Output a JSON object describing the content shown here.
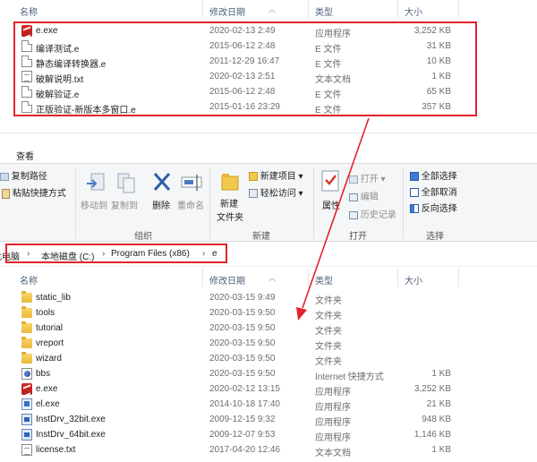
{
  "columns": {
    "name": "名称",
    "date": "修改日期",
    "type": "类型",
    "size": "大小"
  },
  "top_files": [
    {
      "icon": "exe-icon",
      "name": "e.exe",
      "date": "2020-02-13 2:49",
      "type": "应用程序",
      "size": "3,252 KB"
    },
    {
      "icon": "document-icon",
      "name": "编译测试.e",
      "date": "2015-06-12 2:48",
      "type": "E 文件",
      "size": "31 KB"
    },
    {
      "icon": "document-icon",
      "name": "静态编译转换器.e",
      "date": "2011-12-29 16:47",
      "type": "E 文件",
      "size": "10 KB"
    },
    {
      "icon": "text-file-icon",
      "name": "破解说明.txt",
      "date": "2020-02-13 2:51",
      "type": "文本文档",
      "size": "1 KB"
    },
    {
      "icon": "document-icon",
      "name": "破解验证.e",
      "date": "2015-06-12 2:48",
      "type": "E 文件",
      "size": "65 KB"
    },
    {
      "icon": "document-icon",
      "name": "正版验证-新版本多窗口.e",
      "date": "2015-01-16 23:29",
      "type": "E 文件",
      "size": "357 KB"
    }
  ],
  "ribbon": {
    "tab": "查看",
    "copy_path": "复制路径",
    "paste_shortcut": "粘贴快捷方式",
    "move_to": "移动到",
    "copy_to": "复制到",
    "delete": "删除",
    "rename": "重命名",
    "new_folder_1": "新建",
    "new_folder_2": "文件夹",
    "new_item": "新建项目",
    "easy_access": "轻松访问",
    "properties": "属性",
    "open": "打开",
    "edit": "编辑",
    "history": "历史记录",
    "select_all": "全部选择",
    "select_none": "全部取消",
    "invert_selection": "反向选择",
    "group_organize": "组织",
    "group_new": "新建",
    "group_open": "打开",
    "group_select": "选择"
  },
  "address": {
    "crumbs": [
      "此电脑",
      "本地磁盘 (C:)",
      "Program Files (x86)",
      "e"
    ],
    "separator": "›"
  },
  "bottom_files": [
    {
      "icon": "folder-icon",
      "name": "static_lib",
      "date": "2020-03-15 9:49",
      "type": "文件夹",
      "size": ""
    },
    {
      "icon": "folder-icon",
      "name": "tools",
      "date": "2020-03-15 9:50",
      "type": "文件夹",
      "size": ""
    },
    {
      "icon": "folder-icon",
      "name": "tutorial",
      "date": "2020-03-15 9:50",
      "type": "文件夹",
      "size": ""
    },
    {
      "icon": "folder-icon",
      "name": "vreport",
      "date": "2020-03-15 9:50",
      "type": "文件夹",
      "size": ""
    },
    {
      "icon": "folder-icon",
      "name": "wizard",
      "date": "2020-03-15 9:50",
      "type": "文件夹",
      "size": ""
    },
    {
      "icon": "internet-shortcut-icon",
      "name": "bbs",
      "date": "2020-03-15 9:50",
      "type": "Internet 快捷方式",
      "size": "1 KB"
    },
    {
      "icon": "exe-icon",
      "name": "e.exe",
      "date": "2020-02-12 13:15",
      "type": "应用程序",
      "size": "3,252 KB"
    },
    {
      "icon": "app-icon",
      "name": "el.exe",
      "date": "2014-10-18 17:40",
      "type": "应用程序",
      "size": "21 KB"
    },
    {
      "icon": "installer-icon",
      "name": "InstDrv_32bit.exe",
      "date": "2009-12-15 9:32",
      "type": "应用程序",
      "size": "948 KB"
    },
    {
      "icon": "installer-icon",
      "name": "InstDrv_64bit.exe",
      "date": "2009-12-07 9:53",
      "type": "应用程序",
      "size": "1,146 KB"
    },
    {
      "icon": "text-file-icon",
      "name": "license.txt",
      "date": "2017-04-20 12:46",
      "type": "文本文档",
      "size": "1 KB"
    }
  ],
  "colors": {
    "highlight_red": "#e2232a",
    "header_text": "#4c607a"
  }
}
